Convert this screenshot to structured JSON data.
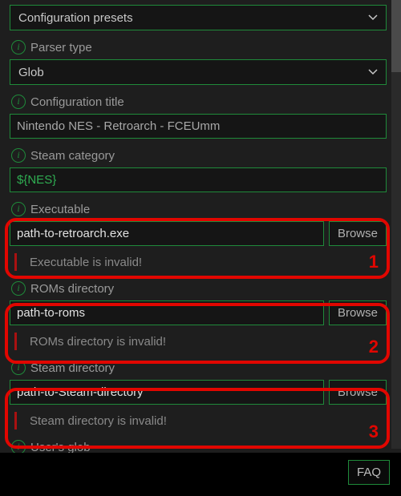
{
  "presets": {
    "label": "Configuration presets"
  },
  "parser_type": {
    "label": "Parser type",
    "value": "Glob"
  },
  "config_title": {
    "label": "Configuration title",
    "value": "Nintendo NES - Retroarch - FCEUmm"
  },
  "steam_category": {
    "label": "Steam category",
    "value": "${NES}"
  },
  "executable": {
    "label": "Executable",
    "value": "path-to-retroarch.exe",
    "browse": "Browse",
    "error": "Executable is invalid!"
  },
  "roms_dir": {
    "label": "ROMs directory",
    "value": "path-to-roms",
    "browse": "Browse",
    "error": "ROMs directory is invalid!"
  },
  "steam_dir": {
    "label": "Steam directory",
    "value": "path-to-Steam-directory",
    "browse": "Browse",
    "error": "Steam directory is invalid!"
  },
  "users_glob": {
    "label": "User's glob"
  },
  "annotations": {
    "n1": "1",
    "n2": "2",
    "n3": "3"
  },
  "faq": "FAQ"
}
